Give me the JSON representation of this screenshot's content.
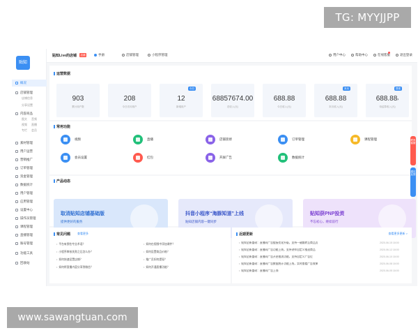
{
  "watermarks": {
    "top": "TG: MYYJJPP",
    "bottom": "www.sawangtuan.com"
  },
  "app": {
    "logo": "贴知",
    "colors": {
      "accent": "#3b8ff3",
      "red": "#ff5a4e"
    },
    "topbar": {
      "shop_name": "贴知Live的店铺",
      "shop_tag": "店铺",
      "items": [
        "手册",
        "店铺管理",
        "小程序管理"
      ],
      "right_items": [
        "用户中心",
        "帮助中心",
        "在线客服",
        "退出登录"
      ]
    },
    "sidebar": {
      "items": [
        {
          "label": "概况",
          "icon": "home-icon",
          "active": true
        },
        {
          "label": "店铺管理",
          "icon": "shop-icon"
        },
        {
          "label": "内容商品",
          "icon": "goods-icon"
        },
        {
          "label": "素材管理",
          "icon": "media-icon"
        },
        {
          "label": "用户运营",
          "icon": "users-icon"
        },
        {
          "label": "营销推广",
          "icon": "promo-icon"
        },
        {
          "label": "订单管理",
          "icon": "order-icon"
        },
        {
          "label": "资金管理",
          "icon": "finance-icon"
        },
        {
          "label": "数据统计",
          "icon": "chart-icon"
        },
        {
          "label": "用户管理",
          "icon": "user-icon"
        },
        {
          "label": "应用管理",
          "icon": "app-icon"
        },
        {
          "label": "设置中心",
          "icon": "settings-icon"
        },
        {
          "label": "操作员管理",
          "icon": "operator-icon"
        },
        {
          "label": "课程管理",
          "icon": "course-icon"
        },
        {
          "label": "直播管理",
          "icon": "live-icon"
        },
        {
          "label": "账号管理",
          "icon": "account-icon"
        },
        {
          "label": "功能工具",
          "icon": "tools-icon"
        },
        {
          "label": "回收站",
          "icon": "trash-icon"
        }
      ],
      "subs": [
        "店铺信息",
        "分享设置",
        "图文",
        "音频",
        "视频",
        "直播",
        "专栏",
        "会员"
      ]
    },
    "sections": {
      "operation": "运营数据",
      "common": "常用功能",
      "products": "产品动态",
      "faq": "常见问题",
      "faq_link": "查看更多",
      "updates": "近期更新",
      "updates_more": "查看更多更新 >"
    },
    "stats": [
      {
        "value": "903",
        "label": "累计用户数"
      },
      {
        "value": "208",
        "label": "今日访问用户"
      },
      {
        "value": "12",
        "label": "新增用户",
        "badge": "今日"
      },
      {
        "value": "68857674.00",
        "label": "总收入(元)"
      },
      {
        "value": "688.88",
        "label": "今日收入(元)"
      },
      {
        "value": "688.88",
        "label": "本月收入(元)",
        "badge": "本月"
      },
      {
        "value": "688.88",
        "label": "待结算收入(元)",
        "badge": "提现",
        "caret": "›"
      }
    ],
    "functions": [
      {
        "label": "视频",
        "color": "#3b8ff3",
        "icon": "video-icon"
      },
      {
        "label": "直播",
        "color": "#22c07a",
        "icon": "live-icon"
      },
      {
        "label": "店铺装修",
        "color": "#8a63e8",
        "icon": "decorate-icon"
      },
      {
        "label": "订单管理",
        "color": "#3b8ff3",
        "icon": "order-icon"
      },
      {
        "label": "课程管理",
        "color": "#f6b928",
        "icon": "course-icon"
      },
      {
        "label": "会员设置",
        "color": "#3b8ff3",
        "icon": "vip-icon"
      },
      {
        "label": "红包",
        "color": "#ff5a4e",
        "icon": "redpacket-icon"
      },
      {
        "label": "开屏广告",
        "color": "#8a63e8",
        "icon": "ad-icon"
      },
      {
        "label": "数据统计",
        "color": "#22c07a",
        "icon": "stats-icon"
      }
    ],
    "banners": [
      {
        "line1": "取消贴知店铺基础版",
        "line2": "提供更好的服务",
        "bg": "#d9e7fb",
        "fg": "#2f6fd1"
      },
      {
        "line1": "抖音小程序“海豚知道”上线",
        "line2": "贴知店铺内容一键同步",
        "bg": "#e6e9fb",
        "fg": "#3b57c9"
      },
      {
        "line1": "贴知获PNP投资",
        "line2": "不忘初心，继续前行",
        "bg": "#eee2fb",
        "fg": "#7a3fd1"
      }
    ],
    "faq": [
      "平台有那些专业术语？",
      "小程序审核失败之后怎么办？",
      "如何快速设置店铺？",
      "如何将直播内容分享到微信？",
      "如何在视频中添加课件？",
      "如何设置商品价格？",
      "推广员如何提现？",
      "如何开通直播功能？"
    ],
    "updates": [
      {
        "text": "贴知全新重磅：直播间广告链接优化升级，支持一键跳转至商品页",
        "date": "2020-06-15 18:00"
      },
      {
        "text": "贴知全新重磅：直播间广告功能上线，支持讲师自定义推送商品",
        "date": "2020-06-12 18:00"
      },
      {
        "text": "贴知全新重磅：直播间广告开启推流功能，支持自定义广告位",
        "date": "2020-06-10 18:00"
      },
      {
        "text": "贴知全新重磅：直播间广告数据统计功能上线，实时查看广告效果",
        "date": "2020-06-08 18:00"
      },
      {
        "text": "贴知全新重磅：直播间广告上线",
        "date": "2020-06-05 18:00"
      }
    ],
    "floats": [
      "联系客服",
      "建议反馈"
    ]
  }
}
